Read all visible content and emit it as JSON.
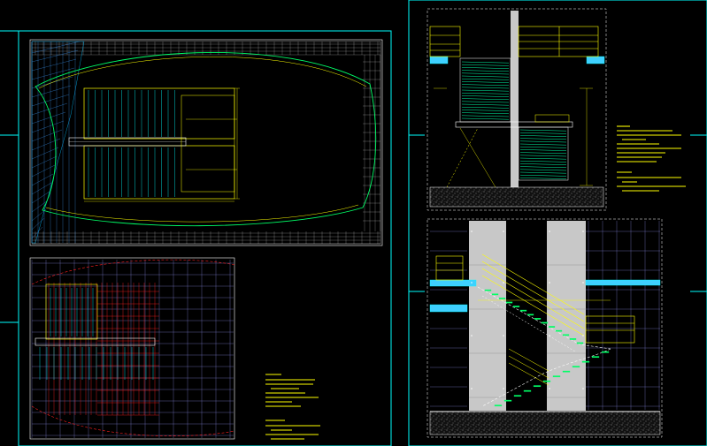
{
  "colors": {
    "background": "#000000",
    "frame": "#00ffff",
    "grid": "#ffffff",
    "dims": "#ffff00",
    "hatch": "#00ffff",
    "red": "#ff2020",
    "green": "#00ff66",
    "glass": "#c8c8c8"
  },
  "labels": {
    "plan_top_title": "",
    "plan_bottom_title": "",
    "section_title": "",
    "elevation_title": "",
    "plan_note_block": "",
    "section_note_block": ""
  }
}
